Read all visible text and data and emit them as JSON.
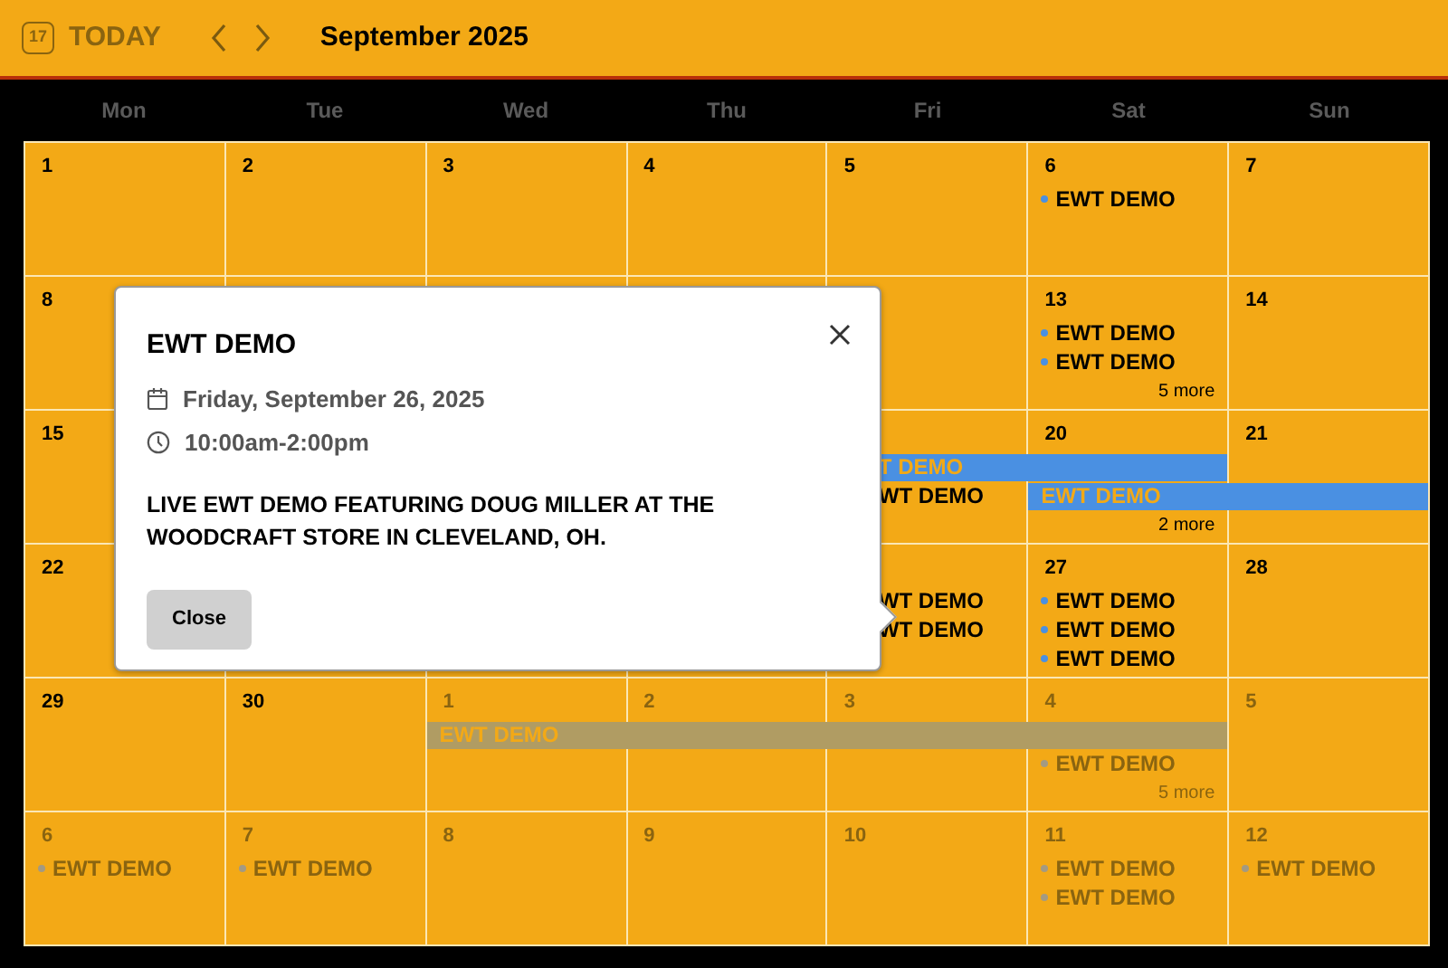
{
  "header": {
    "today_icon_text": "17",
    "today": "TODAY",
    "title": "September 2025"
  },
  "weekdays": [
    "Mon",
    "Tue",
    "Wed",
    "Thu",
    "Fri",
    "Sat",
    "Sun"
  ],
  "weeks": [
    {
      "days": [
        {
          "kind": "day",
          "date": "1",
          "dim": false
        },
        {
          "kind": "day",
          "date": "2",
          "dim": false
        },
        {
          "kind": "day",
          "date": "3",
          "dim": false
        },
        {
          "kind": "day",
          "date": "4",
          "dim": false
        },
        {
          "kind": "day",
          "date": "5",
          "dim": false
        },
        {
          "kind": "day",
          "date": "6",
          "dim": false,
          "lanes": [
            {
              "kind": "event",
              "text": "EWT DEMO"
            }
          ]
        },
        {
          "kind": "day",
          "date": "7",
          "dim": false
        }
      ]
    },
    {
      "days": [
        {
          "kind": "day",
          "date": "8",
          "dim": false
        },
        {
          "kind": "covered"
        },
        {
          "kind": "covered"
        },
        {
          "kind": "covered"
        },
        {
          "kind": "clipped"
        },
        {
          "kind": "day",
          "date": "13",
          "dim": false,
          "lanes": [
            {
              "kind": "event",
              "text": "EWT DEMO"
            },
            {
              "kind": "event",
              "text": "EWT DEMO"
            },
            {
              "kind": "more",
              "text": "5 more"
            }
          ]
        },
        {
          "kind": "day",
          "date": "14",
          "dim": false
        }
      ]
    },
    {
      "days": [
        {
          "kind": "day",
          "date": "15",
          "dim": false
        },
        {
          "kind": "covered"
        },
        {
          "kind": "covered"
        },
        {
          "kind": "covered"
        },
        {
          "kind": "clipped",
          "lanes": [
            {
              "kind": "bar",
              "text": "T DEMO",
              "color": "#4a90e2"
            },
            {
              "kind": "event",
              "text": "WT DEMO"
            }
          ]
        },
        {
          "kind": "day",
          "date": "20",
          "dim": false,
          "lanes": [
            {
              "kind": "bar_continued"
            },
            {
              "kind": "bar",
              "text": "EWT DEMO",
              "color": "#4a90e2"
            },
            {
              "kind": "more",
              "text": "2 more"
            }
          ]
        },
        {
          "kind": "day",
          "date": "21",
          "dim": false,
          "lanes": [
            {
              "kind": "empty"
            },
            {
              "kind": "bar_continued"
            }
          ]
        }
      ]
    },
    {
      "days": [
        {
          "kind": "day",
          "date": "22",
          "dim": false
        },
        {
          "kind": "covered"
        },
        {
          "kind": "covered"
        },
        {
          "kind": "covered"
        },
        {
          "kind": "clipped",
          "lanes": [
            {
              "kind": "event",
              "text": "WT DEMO"
            },
            {
              "kind": "event",
              "text": "WT DEMO"
            }
          ]
        },
        {
          "kind": "day",
          "date": "27",
          "dim": false,
          "lanes": [
            {
              "kind": "event",
              "text": "EWT DEMO"
            },
            {
              "kind": "event",
              "text": "EWT DEMO"
            },
            {
              "kind": "event",
              "text": "EWT DEMO"
            }
          ]
        },
        {
          "kind": "day",
          "date": "28",
          "dim": false
        }
      ]
    },
    {
      "days": [
        {
          "kind": "day",
          "date": "29",
          "dim": false
        },
        {
          "kind": "day",
          "date": "30",
          "dim": false
        },
        {
          "kind": "day",
          "date": "1",
          "dim": true,
          "lanes": [
            {
              "kind": "bar",
              "text": "EWT DEMO",
              "color": "#b09c63"
            }
          ]
        },
        {
          "kind": "day",
          "date": "2",
          "dim": true,
          "lanes": [
            {
              "kind": "bar_continued"
            }
          ]
        },
        {
          "kind": "day",
          "date": "3",
          "dim": true,
          "lanes": [
            {
              "kind": "bar_continued"
            }
          ]
        },
        {
          "kind": "day",
          "date": "4",
          "dim": true,
          "lanes": [
            {
              "kind": "bar_continued"
            },
            {
              "kind": "event",
              "text": "EWT DEMO"
            },
            {
              "kind": "more",
              "text": "5 more"
            }
          ]
        },
        {
          "kind": "day",
          "date": "5",
          "dim": true
        }
      ]
    },
    {
      "days": [
        {
          "kind": "day",
          "date": "6",
          "dim": true,
          "lanes": [
            {
              "kind": "event",
              "text": "EWT DEMO"
            }
          ]
        },
        {
          "kind": "day",
          "date": "7",
          "dim": true,
          "lanes": [
            {
              "kind": "event",
              "text": "EWT DEMO"
            }
          ]
        },
        {
          "kind": "day",
          "date": "8",
          "dim": true
        },
        {
          "kind": "day",
          "date": "9",
          "dim": true
        },
        {
          "kind": "day",
          "date": "10",
          "dim": true
        },
        {
          "kind": "day",
          "date": "11",
          "dim": true,
          "lanes": [
            {
              "kind": "event",
              "text": "EWT DEMO"
            },
            {
              "kind": "event",
              "text": "EWT DEMO"
            }
          ]
        },
        {
          "kind": "day",
          "date": "12",
          "dim": true,
          "lanes": [
            {
              "kind": "event",
              "text": "EWT DEMO"
            }
          ]
        }
      ]
    }
  ],
  "popup": {
    "title": "EWT DEMO",
    "date": "Friday, September 26, 2025",
    "time": "10:00am-2:00pm",
    "description": "LIVE EWT DEMO FEATURING DOUG MILLER AT THE WOODCRAFT STORE IN CLEVELAND, OH.",
    "button": "Close"
  }
}
